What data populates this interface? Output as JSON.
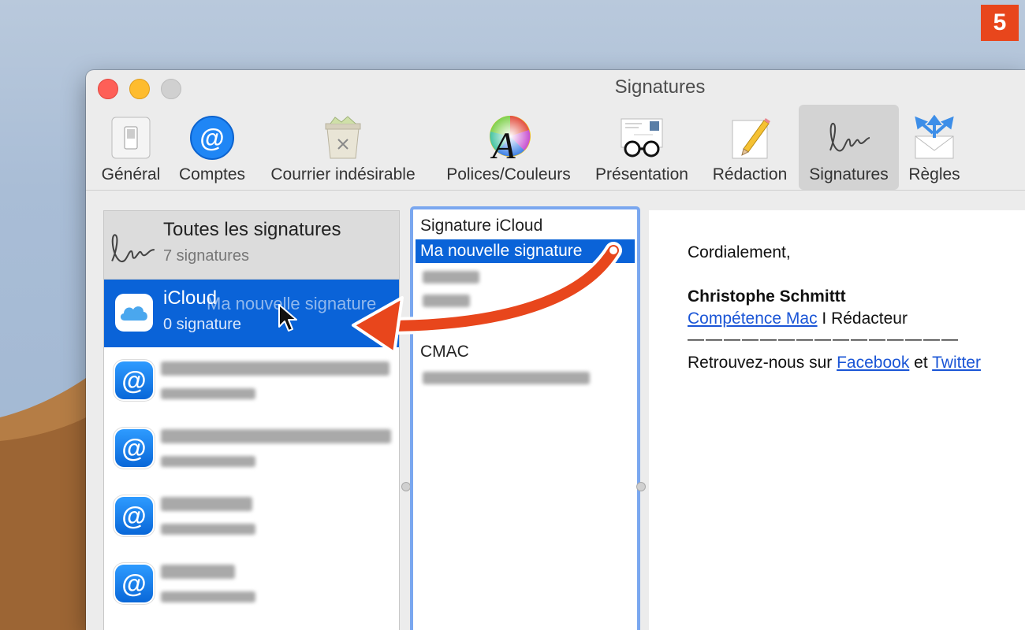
{
  "badge": "5",
  "window": {
    "title": "Signatures"
  },
  "toolbar": {
    "items": [
      {
        "label": "Général",
        "icon": "switch-icon"
      },
      {
        "label": "Comptes",
        "icon": "at-icon"
      },
      {
        "label": "Courrier indésirable",
        "icon": "trash-icon"
      },
      {
        "label": "Polices/Couleurs",
        "icon": "font-color-icon"
      },
      {
        "label": "Présentation",
        "icon": "glasses-letter-icon"
      },
      {
        "label": "Rédaction",
        "icon": "pencil-icon"
      },
      {
        "label": "Signatures",
        "icon": "signature-icon",
        "active": true
      },
      {
        "label": "Règles",
        "icon": "envelope-arrows-icon"
      }
    ]
  },
  "accounts": {
    "header": {
      "name": "Toutes les signatures",
      "count": "7 signatures"
    },
    "selected": {
      "name": "iCloud",
      "count": "0 signature",
      "ghost": "Ma nouvelle signature"
    }
  },
  "signatures": {
    "items": [
      "Signature iCloud",
      "Ma nouvelle signature",
      "CMAC"
    ]
  },
  "preview": {
    "greeting": "Cordialement,",
    "name": "Christophe Schmittt",
    "company_link": "Compétence Mac",
    "role_sep": " I Rédacteur",
    "divider": "———————————————",
    "follow_text": "Retrouvez-nous sur ",
    "facebook": "Facebook",
    "and": " et ",
    "twitter": "Twitter"
  },
  "colors": {
    "selection": "#0a63d8",
    "badge": "#e8461c",
    "arrow": "#e8461c",
    "link": "#1a55d6"
  }
}
